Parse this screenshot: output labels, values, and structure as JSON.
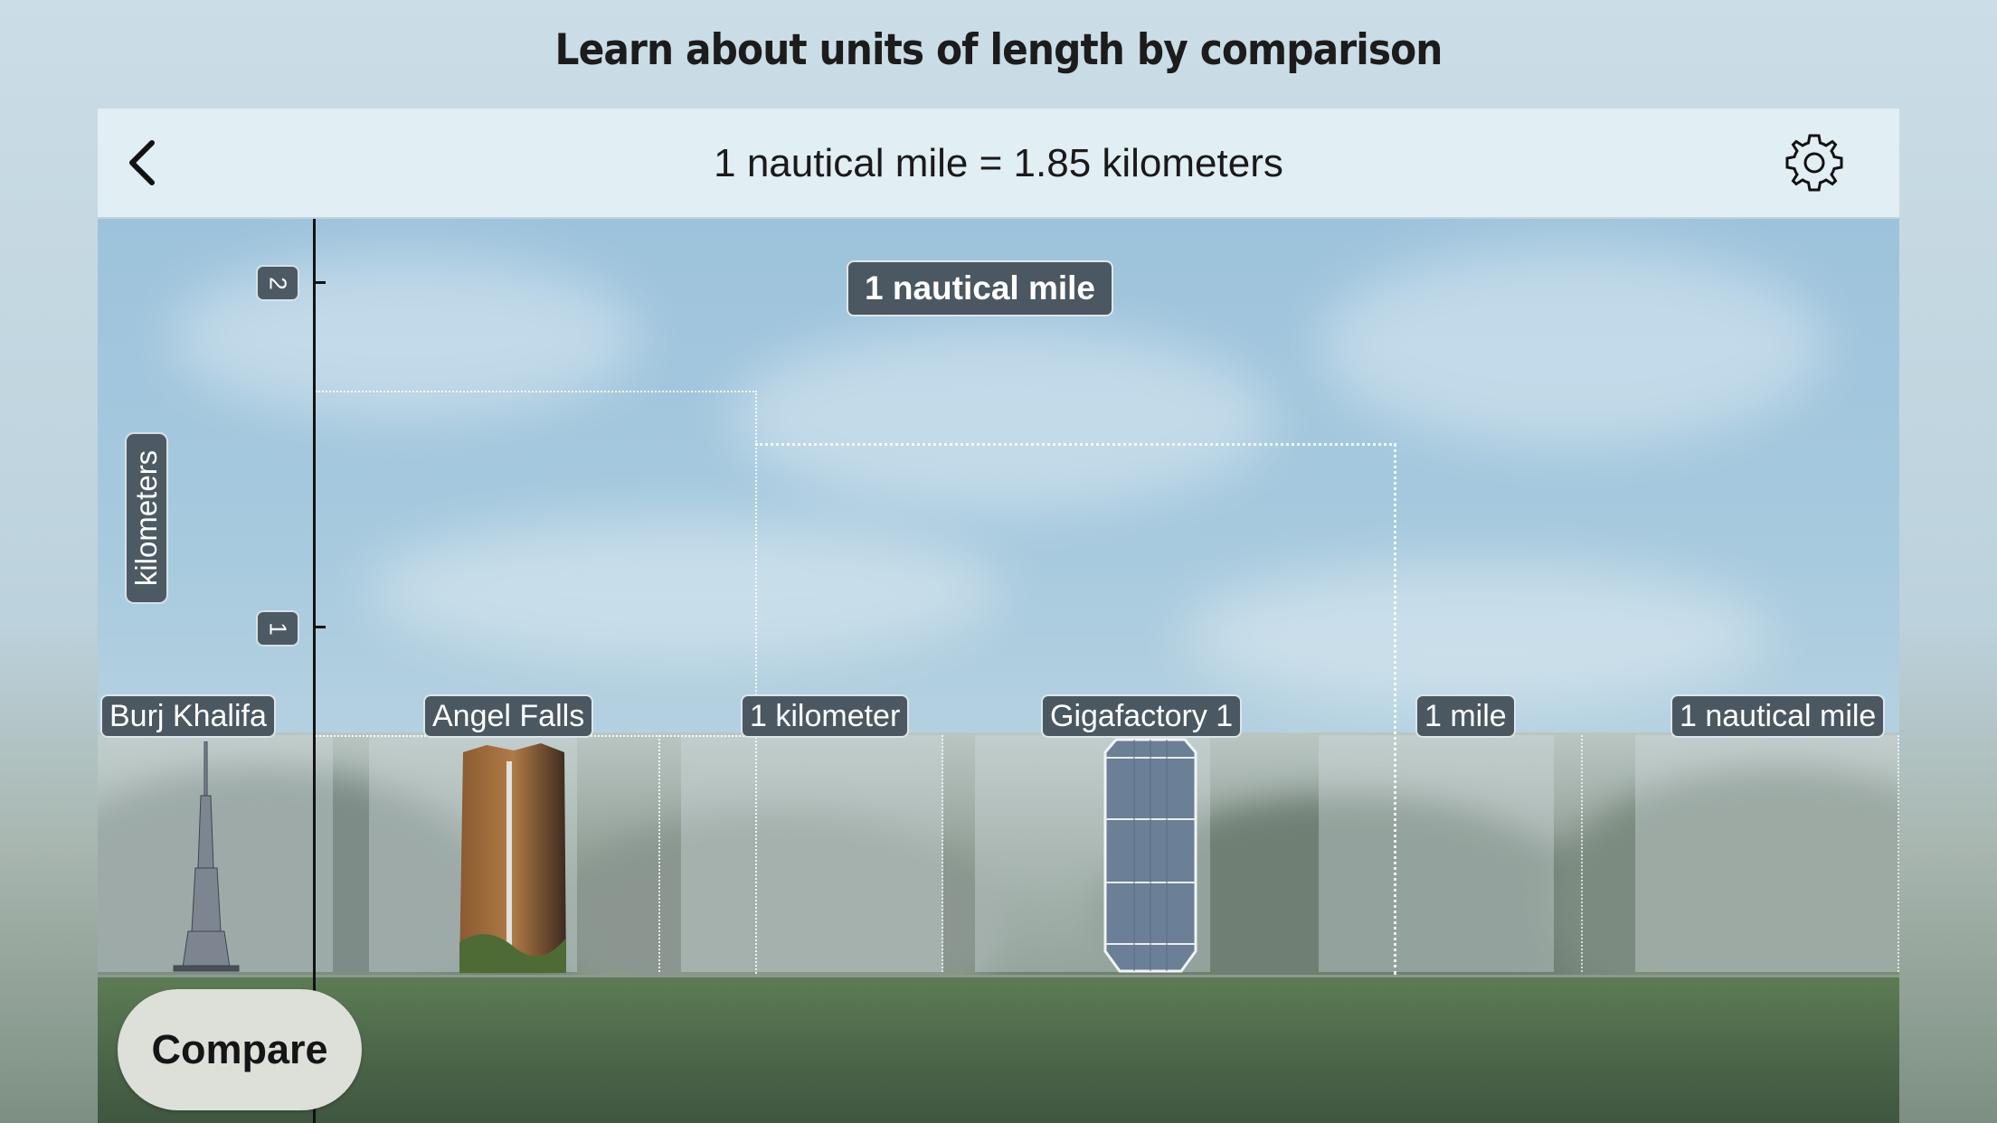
{
  "page": {
    "title": "Learn about units of length by comparison"
  },
  "navbar": {
    "back_icon": "chevron-left-icon",
    "equation": "1 nautical mile =  1.85 kilometers",
    "settings_icon": "gear-icon"
  },
  "chart": {
    "axis_unit": "kilometers",
    "ticks": [
      {
        "value": 1,
        "label": "1"
      },
      {
        "value": 2,
        "label": "2"
      }
    ],
    "highlight_label": "1 nautical mile",
    "items": [
      {
        "label": "Burj Khalifa",
        "image": "burj-khalifa-image"
      },
      {
        "label": "Angel Falls",
        "image": "angel-falls-image"
      },
      {
        "label": "1 kilometer"
      },
      {
        "label": "Gigafactory 1",
        "image": "gigafactory-image"
      },
      {
        "label": "1 mile"
      },
      {
        "label": "1 nautical mile"
      }
    ]
  },
  "compare_button": {
    "label": "Compare"
  }
}
